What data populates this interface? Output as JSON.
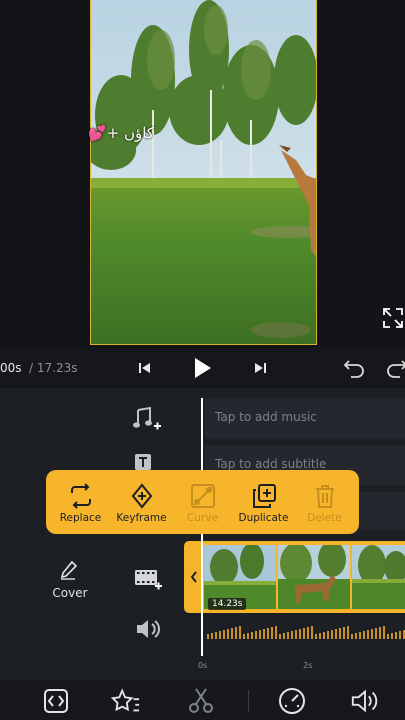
{
  "preview": {
    "overlay_text": "کاؤں +💕"
  },
  "transport": {
    "time_current": "00s",
    "time_total": "/ 17.23s"
  },
  "tracks": {
    "music_placeholder": "Tap to add music",
    "subtitle_placeholder": "Tap to add subtitle"
  },
  "cover": {
    "label": "Cover"
  },
  "clip": {
    "duration": "14.23s"
  },
  "ruler": {
    "labels": [
      "0s",
      "2s"
    ]
  },
  "popup": {
    "items": [
      {
        "label": "Replace",
        "icon": "replace-icon",
        "enabled": true
      },
      {
        "label": "Keyframe",
        "icon": "keyframe-icon",
        "enabled": true
      },
      {
        "label": "Curve",
        "icon": "curve-icon",
        "enabled": false
      },
      {
        "label": "Duplicate",
        "icon": "duplicate-icon",
        "enabled": true
      },
      {
        "label": "Delete",
        "icon": "trash-icon",
        "enabled": false
      }
    ]
  },
  "bottom_toolbar": {
    "icons": [
      "split-code-icon",
      "effects-star-icon",
      "scissors-icon",
      "speed-gauge-icon",
      "volume-icon"
    ]
  },
  "colors": {
    "accent": "#f6b52b",
    "background": "#15171b",
    "timeline_bg": "#1c1f24"
  }
}
